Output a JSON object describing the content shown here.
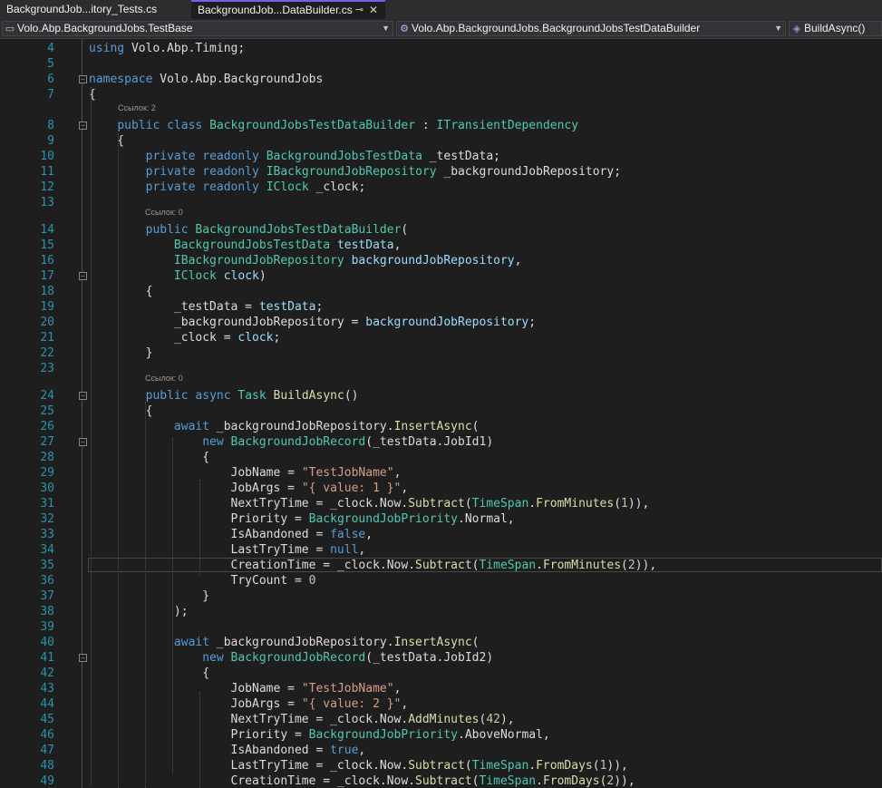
{
  "tabs": [
    {
      "label": "BackgroundJob...itory_Tests.cs",
      "active": false
    },
    {
      "label": "BackgroundJob...DataBuilder.cs",
      "active": true,
      "pin_glyph": "⊸",
      "close_glyph": "✕"
    }
  ],
  "navbar": {
    "project": "Volo.Abp.BackgroundJobs.TestBase",
    "class": "Volo.Abp.BackgroundJobs.BackgroundJobsTestDataBuilder",
    "member": "BuildAsync()"
  },
  "code_lens": {
    "refs_2": "Ссылок: 2",
    "refs_0": "Ссылок: 0"
  },
  "lines": [
    {
      "n": "4",
      "t": "using Volo.Abp.Timing;"
    },
    {
      "n": "5",
      "t": ""
    },
    {
      "n": "6",
      "t": "namespace Volo.Abp.BackgroundJobs"
    },
    {
      "n": "7",
      "t": "{"
    },
    {
      "n": "8",
      "t": "    public class BackgroundJobsTestDataBuilder : ITransientDependency"
    },
    {
      "n": "9",
      "t": "    {"
    },
    {
      "n": "10",
      "t": "        private readonly BackgroundJobsTestData _testData;"
    },
    {
      "n": "11",
      "t": "        private readonly IBackgroundJobRepository _backgroundJobRepository;"
    },
    {
      "n": "12",
      "t": "        private readonly IClock _clock;"
    },
    {
      "n": "13",
      "t": ""
    },
    {
      "n": "14",
      "t": "        public BackgroundJobsTestDataBuilder("
    },
    {
      "n": "15",
      "t": "            BackgroundJobsTestData testData,"
    },
    {
      "n": "16",
      "t": "            IBackgroundJobRepository backgroundJobRepository,"
    },
    {
      "n": "17",
      "t": "            IClock clock)"
    },
    {
      "n": "18",
      "t": "        {"
    },
    {
      "n": "19",
      "t": "            _testData = testData;"
    },
    {
      "n": "20",
      "t": "            _backgroundJobRepository = backgroundJobRepository;"
    },
    {
      "n": "21",
      "t": "            _clock = clock;"
    },
    {
      "n": "22",
      "t": "        }"
    },
    {
      "n": "23",
      "t": ""
    },
    {
      "n": "24",
      "t": "        public async Task BuildAsync()"
    },
    {
      "n": "25",
      "t": "        {"
    },
    {
      "n": "26",
      "t": "            await _backgroundJobRepository.InsertAsync("
    },
    {
      "n": "27",
      "t": "                new BackgroundJobRecord(_testData.JobId1)"
    },
    {
      "n": "28",
      "t": "                {"
    },
    {
      "n": "29",
      "t": "                    JobName = \"TestJobName\","
    },
    {
      "n": "30",
      "t": "                    JobArgs = \"{ value: 1 }\","
    },
    {
      "n": "31",
      "t": "                    NextTryTime = _clock.Now.Subtract(TimeSpan.FromMinutes(1)),"
    },
    {
      "n": "32",
      "t": "                    Priority = BackgroundJobPriority.Normal,"
    },
    {
      "n": "33",
      "t": "                    IsAbandoned = false,"
    },
    {
      "n": "34",
      "t": "                    LastTryTime = null,"
    },
    {
      "n": "35",
      "t": "                    CreationTime = _clock.Now.Subtract(TimeSpan.FromMinutes(2)),"
    },
    {
      "n": "36",
      "t": "                    TryCount = 0"
    },
    {
      "n": "37",
      "t": "                }"
    },
    {
      "n": "38",
      "t": "            );"
    },
    {
      "n": "39",
      "t": ""
    },
    {
      "n": "40",
      "t": "            await _backgroundJobRepository.InsertAsync("
    },
    {
      "n": "41",
      "t": "                new BackgroundJobRecord(_testData.JobId2)"
    },
    {
      "n": "42",
      "t": "                {"
    },
    {
      "n": "43",
      "t": "                    JobName = \"TestJobName\","
    },
    {
      "n": "44",
      "t": "                    JobArgs = \"{ value: 2 }\","
    },
    {
      "n": "45",
      "t": "                    NextTryTime = _clock.Now.AddMinutes(42),"
    },
    {
      "n": "46",
      "t": "                    Priority = BackgroundJobPriority.AboveNormal,"
    },
    {
      "n": "47",
      "t": "                    IsAbandoned = true,"
    },
    {
      "n": "48",
      "t": "                    LastTryTime = _clock.Now.Subtract(TimeSpan.FromDays(1)),"
    },
    {
      "n": "49",
      "t": "                    CreationTime = _clock.Now.Subtract(TimeSpan.FromDays(2)),"
    }
  ],
  "colors": {
    "keyword": "#569cd6",
    "type": "#4ec9b0",
    "string": "#d69d85",
    "number": "#b5cea8",
    "param": "#9cdcfe",
    "method": "#dcdcaa",
    "line_number": "#2b91af",
    "background": "#1e1e1e"
  },
  "icons": [
    "csharp-project-icon",
    "class-icon",
    "method-icon",
    "pin-icon",
    "close-icon",
    "dropdown-arrow-icon",
    "fold-collapse-icon"
  ]
}
